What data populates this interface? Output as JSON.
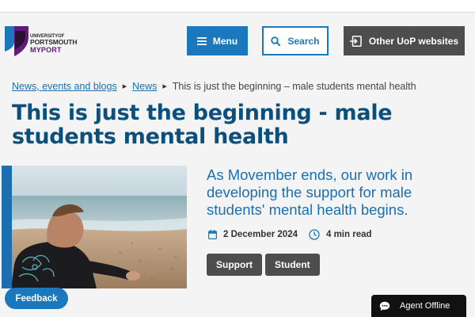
{
  "header": {
    "logo": {
      "line1": "UNIVERSITY",
      "line1_suffix": "OF",
      "line2": "PORTSMOUTH",
      "line3": "MYPORT"
    },
    "menu_label": "Menu",
    "search_label": "Search",
    "other_sites_label": "Other UoP websites"
  },
  "breadcrumb": {
    "items": [
      {
        "label": "News, events and blogs"
      },
      {
        "label": "News"
      }
    ],
    "current": "This is just the beginning – male students mental health"
  },
  "article": {
    "title": "This is just the beginning - male students mental health",
    "intro": "As Movember ends, our work in developing the support for male students' mental health begins.",
    "date": "2 December 2024",
    "read_time": "4 min read",
    "tags": [
      "Support",
      "Student"
    ]
  },
  "widgets": {
    "feedback_label": "Feedback",
    "agent_label": "Agent Offline"
  },
  "colors": {
    "primary_blue": "#1b78bd",
    "title_navy": "#0b4f7c",
    "dark_grey": "#4d4d4d",
    "myport_purple": "#621b7a"
  },
  "icons": [
    "menu-icon",
    "search-icon",
    "external-link-icon",
    "calendar-icon",
    "clock-icon",
    "chat-icon"
  ]
}
